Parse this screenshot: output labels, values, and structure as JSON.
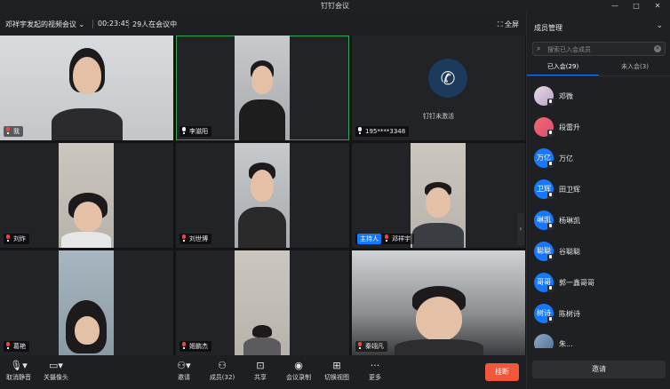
{
  "window": {
    "title": "钉钉会议"
  },
  "header": {
    "meeting_name": "邓祥宇发起的视频会议",
    "elapsed": "00:23:45",
    "count": "29人在会议中",
    "fullscreen": "全屏"
  },
  "tiles": [
    {
      "name": "我"
    },
    {
      "name": "李滋阳"
    },
    {
      "name": "195****3348",
      "status": "钉钉未激活"
    },
    {
      "name": "刘炸"
    },
    {
      "name": "刘世博"
    },
    {
      "name": "邓祥宇",
      "badge": "主持人"
    },
    {
      "name": "葛艳"
    },
    {
      "name": "姬鹏杰"
    },
    {
      "name": "秦翊凡"
    }
  ],
  "toolbar": {
    "mute": "取消静音",
    "camera": "关摄像头",
    "invite": "邀请",
    "members": "成员(32)",
    "share": "共享",
    "record": "会议录制",
    "switch_view": "切换视图",
    "more": "更多",
    "hangup": "挂断"
  },
  "panel": {
    "title": "成员管理",
    "search_placeholder": "搜索已入会成员",
    "tab_joined": "已入会(29)",
    "tab_not_joined": "未入会(3)",
    "members": [
      {
        "name": "邓微",
        "avatar": ""
      },
      {
        "name": "段雷升",
        "avatar": ""
      },
      {
        "name": "万亿",
        "avatar": "万亿"
      },
      {
        "name": "田卫辉",
        "avatar": "卫辉"
      },
      {
        "name": "杨琳凯",
        "avatar": "琳凯"
      },
      {
        "name": "谷聪聪",
        "avatar": "聪聪"
      },
      {
        "name": "郭一鑫哥哥",
        "avatar": "哥哥"
      },
      {
        "name": "陈树诗",
        "avatar": "树诗"
      },
      {
        "name": "朱...",
        "avatar": ""
      }
    ],
    "invite_button": "邀请"
  },
  "colors": {
    "accent": "#1677ff",
    "speaking_border": "#2fa84f",
    "hangup": "#f2573b",
    "avatar_blue": "#1677ff"
  }
}
